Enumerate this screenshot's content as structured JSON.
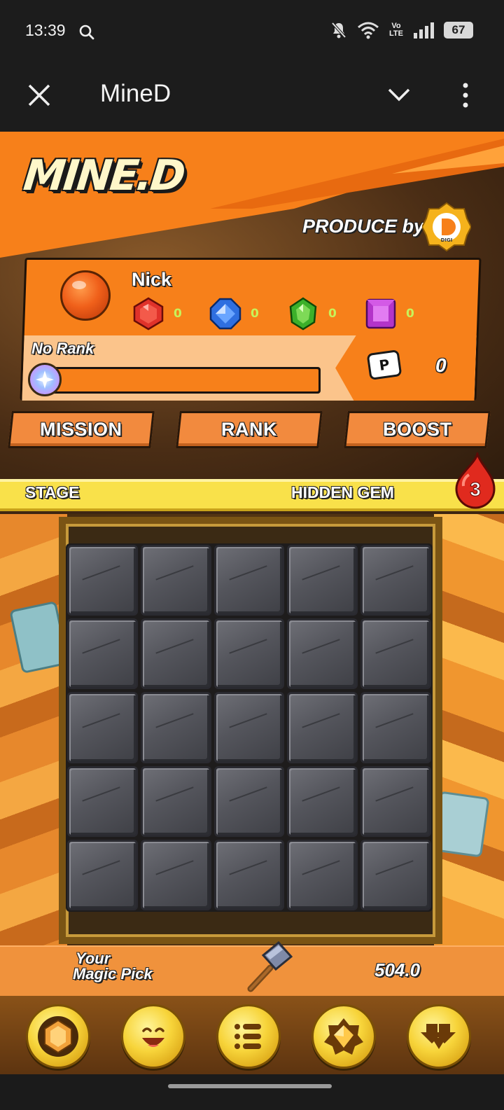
{
  "status_bar": {
    "time": "13:39",
    "battery": "67",
    "volte_top": "Vo",
    "volte_bottom": "LTE"
  },
  "app_bar": {
    "title": "MineD"
  },
  "banner": {
    "logo": "MINE.D",
    "produce_by": "PRODUCE by",
    "digi_label": "DIGI"
  },
  "profile": {
    "name": "Nick",
    "gems": [
      {
        "name": "red-gem",
        "count": "0",
        "color": "#e0322a"
      },
      {
        "name": "blue-gem",
        "count": "0",
        "color": "#2f6fe0"
      },
      {
        "name": "green-gem",
        "count": "0",
        "color": "#3cb02a"
      },
      {
        "name": "purple-gem",
        "count": "0",
        "color": "#b334c9"
      }
    ],
    "rank": "No Rank",
    "rank_progress": 1.0,
    "points_icon": "P",
    "points": "0"
  },
  "nav": {
    "mission": "MISSION",
    "rank": "RANK",
    "boost": "BOOST"
  },
  "stage": {
    "label": "STAGE",
    "mode": "HIDDEN GEM",
    "badge_count": "3"
  },
  "board": {
    "rows": 5,
    "cols": 5
  },
  "magic_pick": {
    "label_line1": "Your",
    "label_line2": "Magic Pick",
    "value": "504.0"
  },
  "dock": [
    {
      "name": "gem-dock-button",
      "icon": "gem-icon"
    },
    {
      "name": "emoji-dock-button",
      "icon": "smile-icon"
    },
    {
      "name": "list-dock-button",
      "icon": "list-icon"
    },
    {
      "name": "star-dock-button",
      "icon": "star-icon"
    },
    {
      "name": "download-dock-button",
      "icon": "down-arrows-icon"
    }
  ],
  "colors": {
    "accent_orange": "#f7801a",
    "stage_yellow": "#f9e14a",
    "badge_red": "#e02a1e"
  }
}
